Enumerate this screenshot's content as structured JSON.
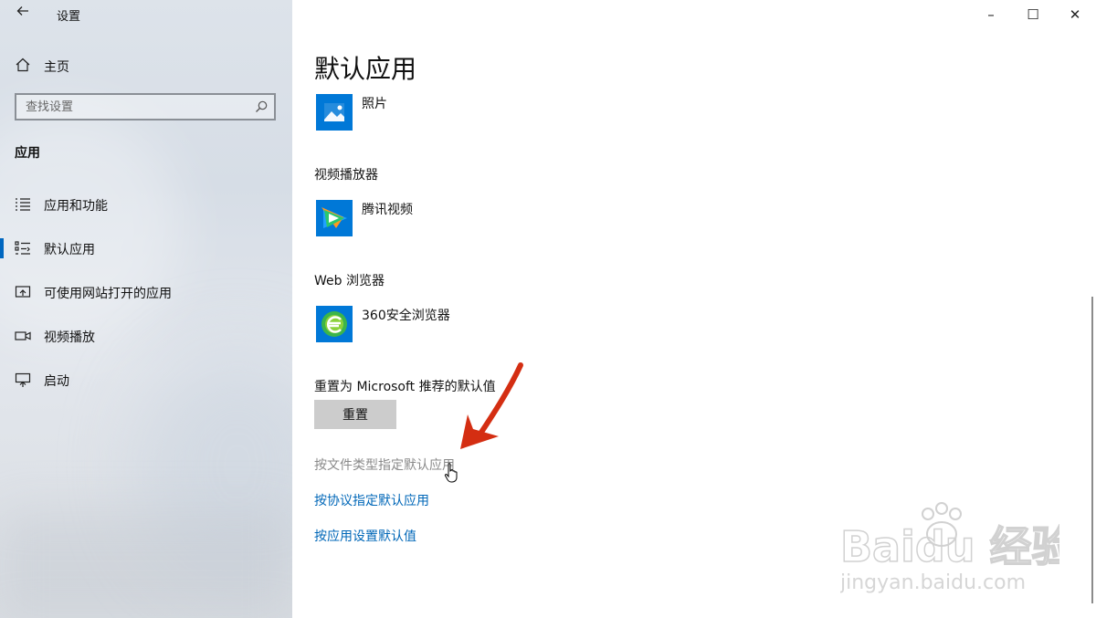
{
  "window": {
    "title": "设置",
    "back_icon": "back-arrow-icon",
    "controls": {
      "minimize": "–",
      "maximize": "☐",
      "close": "✕"
    }
  },
  "sidebar": {
    "home_label": "主页",
    "search_placeholder": "查找设置",
    "section_title": "应用",
    "items": [
      {
        "label": "应用和功能",
        "icon": "apps-features-icon",
        "selected": false
      },
      {
        "label": "默认应用",
        "icon": "default-apps-icon",
        "selected": true
      },
      {
        "label": "可使用网站打开的应用",
        "icon": "apps-for-websites-icon",
        "selected": false
      },
      {
        "label": "视频播放",
        "icon": "video-playback-icon",
        "selected": false
      },
      {
        "label": "启动",
        "icon": "startup-icon",
        "selected": false
      }
    ]
  },
  "main": {
    "page_title": "默认应用",
    "photo_app": {
      "name": "照片",
      "icon": "photos-app-icon"
    },
    "video_player": {
      "label": "视频播放器",
      "app_name": "腾讯视频",
      "icon": "tencent-video-icon"
    },
    "web_browser": {
      "label": "Web 浏览器",
      "app_name": "360安全浏览器",
      "icon": "360-browser-icon"
    },
    "reset": {
      "label": "重置为 Microsoft 推荐的默认值",
      "button_label": "重置"
    },
    "links": [
      "按文件类型指定默认应用",
      "按协议指定默认应用",
      "按应用设置默认值"
    ]
  },
  "watermark": {
    "brand": "Baidu 经验",
    "url": "jingyan.baidu.com"
  },
  "colors": {
    "accent": "#0067c0",
    "link": "#0067b8",
    "tile": "#0078d7",
    "annotation_arrow": "#d42e12"
  }
}
